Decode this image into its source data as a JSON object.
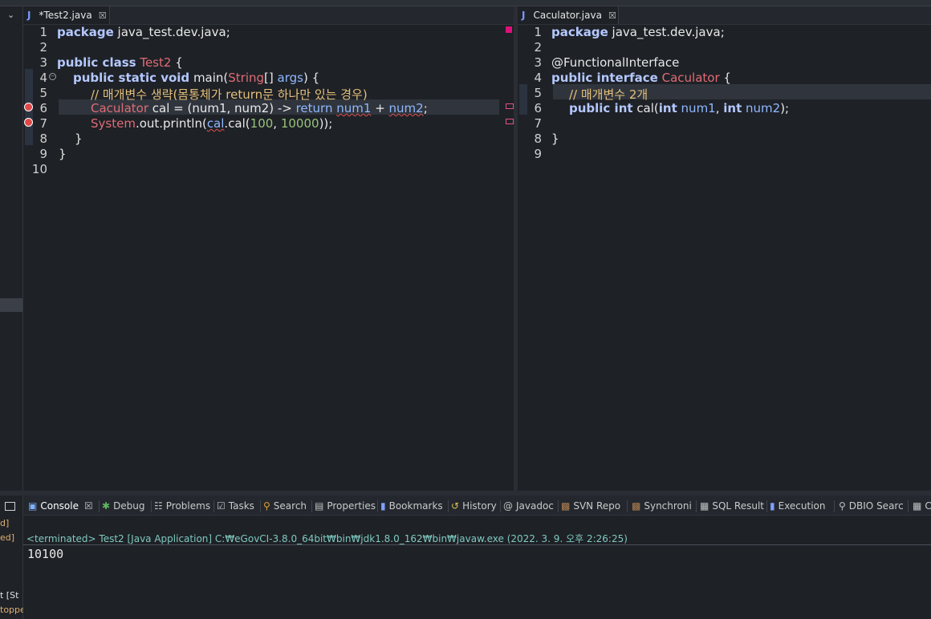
{
  "editor_left": {
    "tab": {
      "label": "*Test2.java"
    },
    "line_numbers": [
      "1",
      "2",
      "3",
      "4",
      "5",
      "6",
      "7",
      "8",
      "9",
      "10"
    ],
    "lines": {
      "l1": {
        "kw": "package",
        "rest": " java_test.dev.java;"
      },
      "l3": {
        "kw": "public class",
        "cls": "Test2",
        "rest": " {"
      },
      "l4": {
        "kw": "public static void",
        "name": " main(",
        "cls": "String",
        "mid": "[] ",
        "var": "args",
        "rest": ") {"
      },
      "l5": {
        "comment": "// 매개변수 생략(몸통체가 return문 하나만 있는 경우)"
      },
      "l6": {
        "cls": "Caculator",
        "a": " cal = (num1, num2) -> ",
        "var1": "return",
        "b": " ",
        "var2": "num1",
        "c": " + ",
        "var3": "num2",
        "d": ";"
      },
      "l7": {
        "cls": "System",
        "a": ".out.println(",
        "err": "cal",
        "b": ".cal(",
        "n1": "100",
        "c": ", ",
        "n2": "10000",
        "d": "));"
      },
      "l8": {
        "rest": "}"
      },
      "l9": {
        "rest": "}"
      }
    }
  },
  "editor_right": {
    "tab": {
      "label": "Caculator.java"
    },
    "line_numbers": [
      "1",
      "2",
      "3",
      "4",
      "5",
      "6",
      "7",
      "8",
      "9"
    ],
    "lines": {
      "l1": {
        "kw": "package",
        "rest": " java_test.dev.java;"
      },
      "l3": {
        "rest": "@FunctionalInterface"
      },
      "l4": {
        "kw": "public interface",
        "cls": "Caculator",
        "rest": " {"
      },
      "l5": {
        "comment": "// 매개변수 2개"
      },
      "l6": {
        "kw1": "public int",
        "a": " cal(",
        "kw2": "int",
        "v1": " num1",
        "b": ", ",
        "kw3": "int",
        "v2": " num2",
        "c": ");"
      },
      "l8": {
        "rest": "}"
      }
    }
  },
  "console": {
    "tabs": [
      {
        "label": "Console",
        "icon": "console-icon"
      },
      {
        "label": "Debug",
        "icon": "bug-icon"
      },
      {
        "label": "Problems",
        "icon": "problems-icon"
      },
      {
        "label": "Tasks",
        "icon": "tasks-icon"
      },
      {
        "label": "Search",
        "icon": "search-icon"
      },
      {
        "label": "Properties",
        "icon": "properties-icon"
      },
      {
        "label": "Bookmarks",
        "icon": "bookmark-icon"
      },
      {
        "label": "History",
        "icon": "history-icon"
      },
      {
        "label": "Javadoc",
        "icon": "at-icon"
      },
      {
        "label": "SVN Repo",
        "icon": "svn-icon"
      },
      {
        "label": "Synchroni",
        "icon": "sync-icon"
      },
      {
        "label": "SQL Result",
        "icon": "table-icon"
      },
      {
        "label": "Execution",
        "icon": "book-icon"
      },
      {
        "label": "DBIO Searc",
        "icon": "search-icon"
      },
      {
        "label": "C",
        "icon": "table-icon"
      }
    ],
    "status": "<terminated> Test2 [Java Application] C:₩eGovCI-3.8.0_64bit₩bin₩jdk1.8.0_162₩bin₩javaw.exe (2022. 3. 9. 오후 2:26:25)",
    "output": "10100"
  },
  "left_panel": {
    "fragments": [
      "d]",
      "ed]",
      "t  [St",
      "toppe"
    ]
  },
  "colors": {
    "background": "#1e2126",
    "keyword": "#b4c8ff",
    "class": "#e06c75",
    "comment": "#e5c07b",
    "number": "#98c379",
    "variable": "#8fb8ff",
    "console_status": "#7fc9c0"
  }
}
